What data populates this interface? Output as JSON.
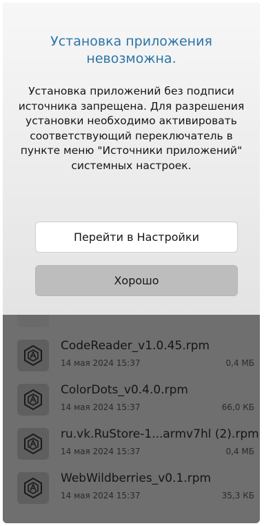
{
  "dialog": {
    "title": "Установка приложения невозможна.",
    "message": "Установка приложений без подписи источника запрещена. Для разрешения установки необходимо активировать соответствующий переключатель в пункте меню \"Источники приложений\" системных настроек.",
    "settings_button": "Перейти в Настройки",
    "ok_button": "Хорошо"
  },
  "files": [
    {
      "name": "CodeReader_v1.0.45.rpm",
      "date": "14 мая 2024 15:37",
      "size": "0,4 МБ",
      "icon": "package-icon"
    },
    {
      "name": "ColorDots_v0.4.0.rpm",
      "date": "14 мая 2024 15:37",
      "size": "66,0 КБ",
      "icon": "package-icon"
    },
    {
      "name": "ru.vk.RuStore-1...armv7hl (2).rpm",
      "date": "14 мая 2024 15:37",
      "size": "0,4 МБ",
      "icon": "package-icon"
    },
    {
      "name": "WebWildberries_v0.1.rpm",
      "date": "14 мая 2024 15:37",
      "size": "35,3 КБ",
      "icon": "package-icon"
    }
  ],
  "colors": {
    "title": "#2a74a8",
    "overlay": "#6f6f6f"
  }
}
